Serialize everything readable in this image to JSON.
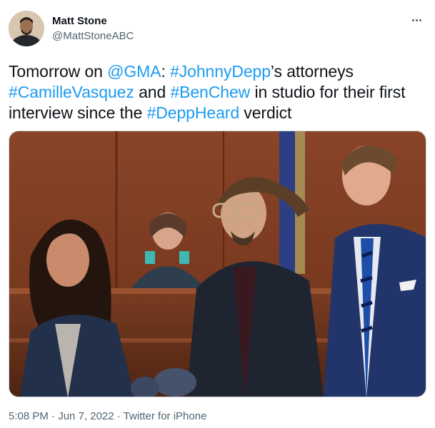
{
  "author": {
    "display_name": "Matt Stone",
    "handle": "@MattStoneABC"
  },
  "tweet": {
    "segments": [
      {
        "text": "Tomorrow on ",
        "link": false
      },
      {
        "text": "@GMA",
        "link": true
      },
      {
        "text": ": ",
        "link": false
      },
      {
        "text": "#JohnnyDepp",
        "link": true
      },
      {
        "text": "’s attorneys ",
        "link": false
      },
      {
        "text": "#CamilleVasquez",
        "link": true
      },
      {
        "text": " and ",
        "link": false
      },
      {
        "text": "#BenChew",
        "link": true
      },
      {
        "text": " in studio for their first interview since the ",
        "link": false
      },
      {
        "text": "#DeppHeard",
        "link": true
      },
      {
        "text": " verdict",
        "link": false
      }
    ]
  },
  "meta": {
    "time": "5:08 PM",
    "separator1": " · ",
    "date": "Jun 7, 2022",
    "separator2": " · ",
    "source": "Twitter for iPhone"
  },
  "colors": {
    "link": "#1d9bf0",
    "text": "#0f1419",
    "secondary": "#536471"
  },
  "icons": {
    "more": "more-horizontal-icon"
  }
}
